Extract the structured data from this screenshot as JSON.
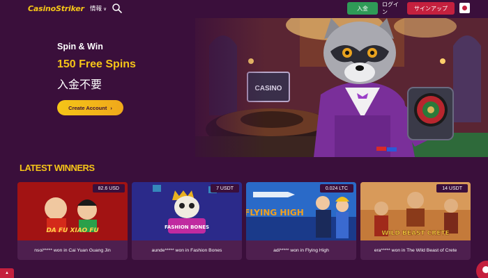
{
  "header": {
    "logo": "CasinoStriker",
    "info_menu": "情報",
    "deposit": "入金",
    "login": "ログイン",
    "signup": "サインアップ",
    "language_flag": "japan-flag-icon"
  },
  "hero": {
    "subtitle": "Spin & Win",
    "title": "150 Free Spins",
    "note": "入金不要",
    "cta": "Create Account",
    "cta_arrow": "›",
    "sign_text": "CASINO"
  },
  "winners": {
    "title": "LATEST WINNERS",
    "items": [
      {
        "amount": "82.6 USD",
        "caption": "nsoi***** won in Cai Yuan Guang Jin",
        "game_text": "DA FU XIAO FU"
      },
      {
        "amount": "7 USDT",
        "caption": "aunde***** won in Fashion Bones",
        "game_text": "FASHION BONES"
      },
      {
        "amount": "0.024 LTC",
        "caption": "adi***** won in Flying High",
        "game_text": "FLYING HIGH"
      },
      {
        "amount": "14 USDT",
        "caption": "era***** won in The Wild Beast of Crete",
        "game_text": "WILD BEAST CRETE"
      }
    ]
  },
  "colors": {
    "background": "#3a0f3b",
    "accent": "#f5c518",
    "deposit": "#2f9a57",
    "signup": "#c4203e",
    "card": "#4e1f4f"
  }
}
